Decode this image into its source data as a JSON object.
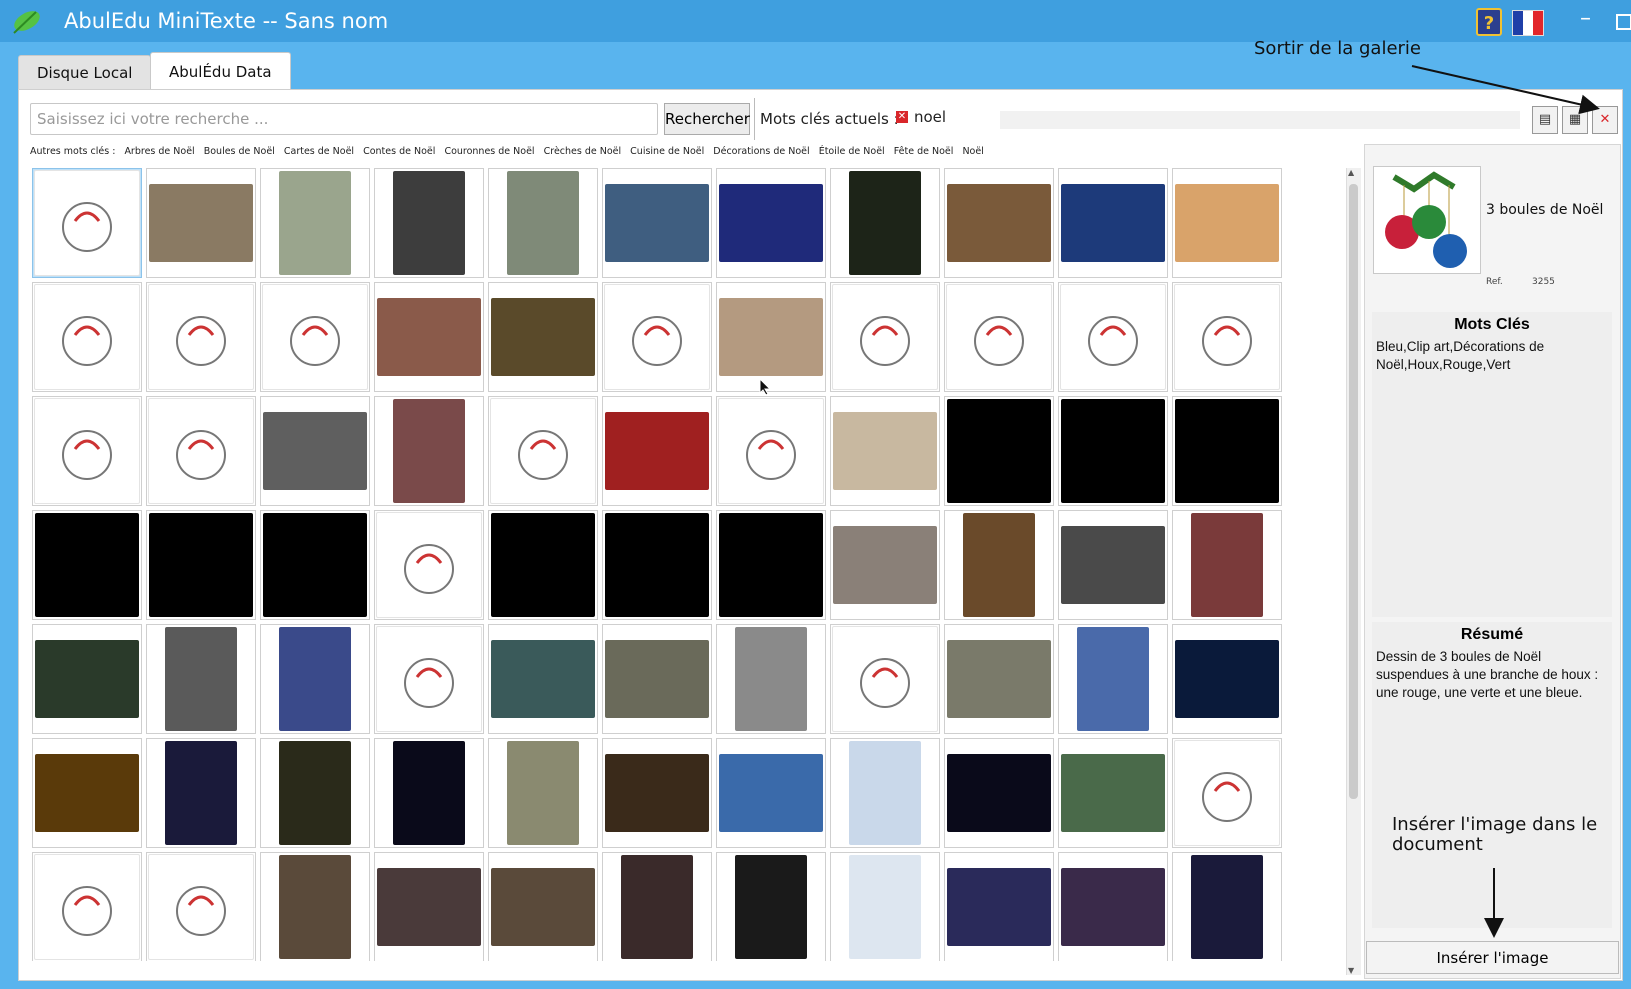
{
  "window": {
    "title": "AbulEdu MiniTexte -- Sans nom"
  },
  "tabs": [
    {
      "label": "Disque Local"
    },
    {
      "label": "AbulÉdu Data"
    }
  ],
  "annotations": {
    "sortir": "Sortir de la galerie",
    "inserer": "Insérer l'image dans le document"
  },
  "search": {
    "placeholder": "Saisissez ici votre recherche ...",
    "button": "Rechercher"
  },
  "current_keywords": {
    "label": "Mots clés actuels :",
    "items": [
      "noel"
    ]
  },
  "other_keywords": {
    "label": "Autres mots clés :",
    "items": [
      "Arbres de Noël",
      "Boules de Noël",
      "Cartes de Noël",
      "Contes de Noël",
      "Couronnes de Noël",
      "Crèches de Noël",
      "Cuisine de Noël",
      "Décorations de Noël",
      "Étoile de Noël",
      "Fête de Noël",
      "Noël"
    ]
  },
  "detail": {
    "title": "3 boules de Noël",
    "ref_label": "Ref.",
    "ref_value": "3255",
    "keywords_heading": "Mots Clés",
    "keywords_text": "Bleu,Clip art,Décorations de Noël,Houx,Rouge,Vert",
    "summary_heading": "Résumé",
    "summary_text": "Dessin de 3 boules de Noël suspendues à une branche de houx : une rouge, une verte et une bleue.",
    "insert_button": "Insérer l'image"
  },
  "colors": {
    "titlebar": "#3f9fdf",
    "background": "#59b4ee",
    "selection": "#bfe1f8",
    "close_red": "#d9262a"
  },
  "thumbnails": [
    [
      "art",
      "#ffffff"
    ],
    [
      "photo",
      "#8a7a63"
    ],
    [
      "tall",
      "#9aa58d"
    ],
    [
      "tall",
      "#3d3d3d"
    ],
    [
      "tall",
      "#7f8a78"
    ],
    [
      "photo",
      "#3f5e80"
    ],
    [
      "photo",
      "#1f2a7a"
    ],
    [
      "tall",
      "#1d2418"
    ],
    [
      "photo",
      "#7a5a3a"
    ],
    [
      "photo",
      "#1d3a7a"
    ],
    [
      "photo",
      "#d9a36a"
    ],
    [
      "art",
      "#ffffff"
    ],
    [
      "art",
      "#ffffff"
    ],
    [
      "art",
      "#ffffff"
    ],
    [
      "photo",
      "#8a5a4a"
    ],
    [
      "photo",
      "#5a4a2a"
    ],
    [
      "art",
      "#ffffff"
    ],
    [
      "photo",
      "#b49a80"
    ],
    [
      "art",
      "#ffffff"
    ],
    [
      "art",
      "#ffffff"
    ],
    [
      "art",
      "#ffffff"
    ],
    [
      "art",
      "#ffffff"
    ],
    [
      "art",
      "#ffffff"
    ],
    [
      "art",
      "#ffffff"
    ],
    [
      "photo",
      "#5f5f5f"
    ],
    [
      "tall",
      "#7a4a4a"
    ],
    [
      "art",
      "#ffffff"
    ],
    [
      "photo",
      "#a02020"
    ],
    [
      "art",
      "#ffffff"
    ],
    [
      "photo",
      "#c8b8a0"
    ],
    [
      "full",
      "#000000"
    ],
    [
      "full",
      "#000000"
    ],
    [
      "full",
      "#000000"
    ],
    [
      "full",
      "#000000"
    ],
    [
      "full",
      "#000000"
    ],
    [
      "full",
      "#000000"
    ],
    [
      "art",
      "#ffffff"
    ],
    [
      "full",
      "#000000"
    ],
    [
      "full",
      "#000000"
    ],
    [
      "full",
      "#000000"
    ],
    [
      "photo",
      "#8a8078"
    ],
    [
      "tall",
      "#6a4a2a"
    ],
    [
      "photo",
      "#4a4a4a"
    ],
    [
      "tall",
      "#7a3a3a"
    ],
    [
      "photo",
      "#2a3a2a"
    ],
    [
      "tall",
      "#5a5a5a"
    ],
    [
      "tall",
      "#3a4a8a"
    ],
    [
      "art",
      "#ffffff"
    ],
    [
      "photo",
      "#3a5a5a"
    ],
    [
      "photo",
      "#6a6a5a"
    ],
    [
      "tall",
      "#8a8a8a"
    ],
    [
      "art",
      "#ffffff"
    ],
    [
      "photo",
      "#7a7a6a"
    ],
    [
      "tall",
      "#4a6aaa"
    ],
    [
      "photo",
      "#0a1a3a"
    ],
    [
      "photo",
      "#5a3a0a"
    ],
    [
      "tall",
      "#1a1a3a"
    ],
    [
      "tall",
      "#2a2a1a"
    ],
    [
      "tall",
      "#0a0a1a"
    ],
    [
      "tall",
      "#8a8a70"
    ],
    [
      "photo",
      "#3a2a1a"
    ],
    [
      "photo",
      "#3a6aaa"
    ],
    [
      "tall",
      "#c9d8ea"
    ],
    [
      "photo",
      "#0a0a1a"
    ],
    [
      "photo",
      "#4a6a4a"
    ],
    [
      "art",
      "#ffffff"
    ],
    [
      "art",
      "#ffffff"
    ],
    [
      "art",
      "#ffffff"
    ],
    [
      "tall",
      "#5a4a3a"
    ],
    [
      "photo",
      "#4a3a3a"
    ],
    [
      "photo",
      "#5a4a3a"
    ],
    [
      "tall",
      "#3a2a2a"
    ],
    [
      "tall",
      "#1a1a1a"
    ],
    [
      "tall",
      "#dde6f0"
    ],
    [
      "photo",
      "#2a2a5a"
    ],
    [
      "photo",
      "#3a2a4a"
    ],
    [
      "tall",
      "#1a1a3a"
    ]
  ]
}
